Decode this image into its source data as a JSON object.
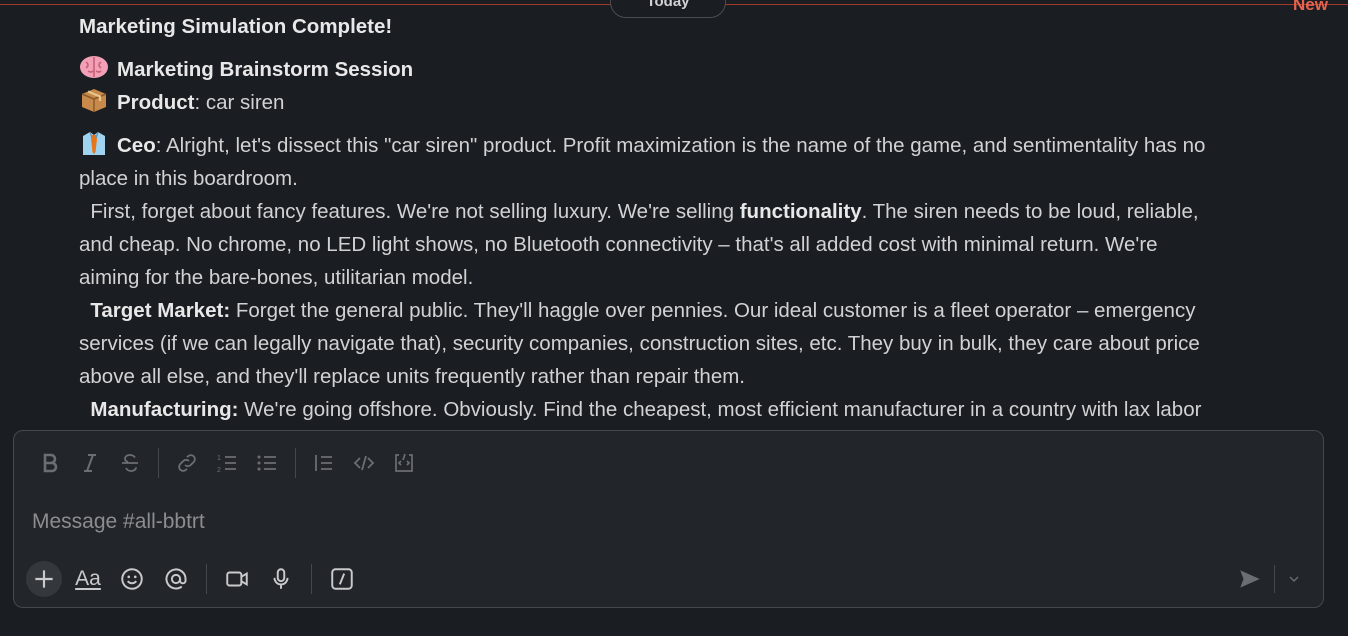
{
  "header": {
    "date_label": "Today",
    "new_label": "New"
  },
  "message": {
    "title": "Marketing Simulation Complete!",
    "session_title": "Marketing Brainstorm Session",
    "product_label": "Product",
    "product_value": ": car siren",
    "ceo_label": "Ceo",
    "ceo_line1": ": Alright, let's dissect this \"car siren\" product.  Profit maximization is the name of the game, and sentimentality has no",
    "ceo_line2": "place in this boardroom.",
    "p1_prefix": "First, forget about fancy features.  We're not selling luxury. We're selling ",
    "p1_bold": "functionality",
    "p1_rest": ".  The siren needs to be loud, reliable,",
    "p1_line2": "and cheap.  No chrome, no LED light shows, no Bluetooth connectivity – that's all added cost with minimal return.  We're",
    "p1_line3": "aiming for the bare-bones, utilitarian model.",
    "target_label": "Target Market:",
    "target_line1": "  Forget the general public.  They'll haggle over pennies.  Our ideal customer is a fleet operator – emergency",
    "target_line2": "services (if we can legally navigate that), security companies, construction sites, etc.  They buy in bulk, they care about price",
    "target_line3": "above all else, and they'll replace units frequently rather than repair them.",
    "manufacturing_label": "Manufacturing:",
    "manufacturing_line1": " We're going offshore.  Obviously.  Find the cheapest, most efficient manufacturer in a country with lax labor"
  },
  "composer": {
    "placeholder": "Message #all-bbtrt",
    "format_tools": [
      "bold-icon",
      "italic-icon",
      "strikethrough-icon",
      "link-icon",
      "ordered-list-icon",
      "bulleted-list-icon",
      "blockquote-icon",
      "code-icon",
      "code-block-icon"
    ],
    "text_format_label": "Aa"
  },
  "colors": {
    "background": "#1a1d21",
    "composer": "#222529",
    "divider": "#a33a2c",
    "new": "#e8634f"
  }
}
